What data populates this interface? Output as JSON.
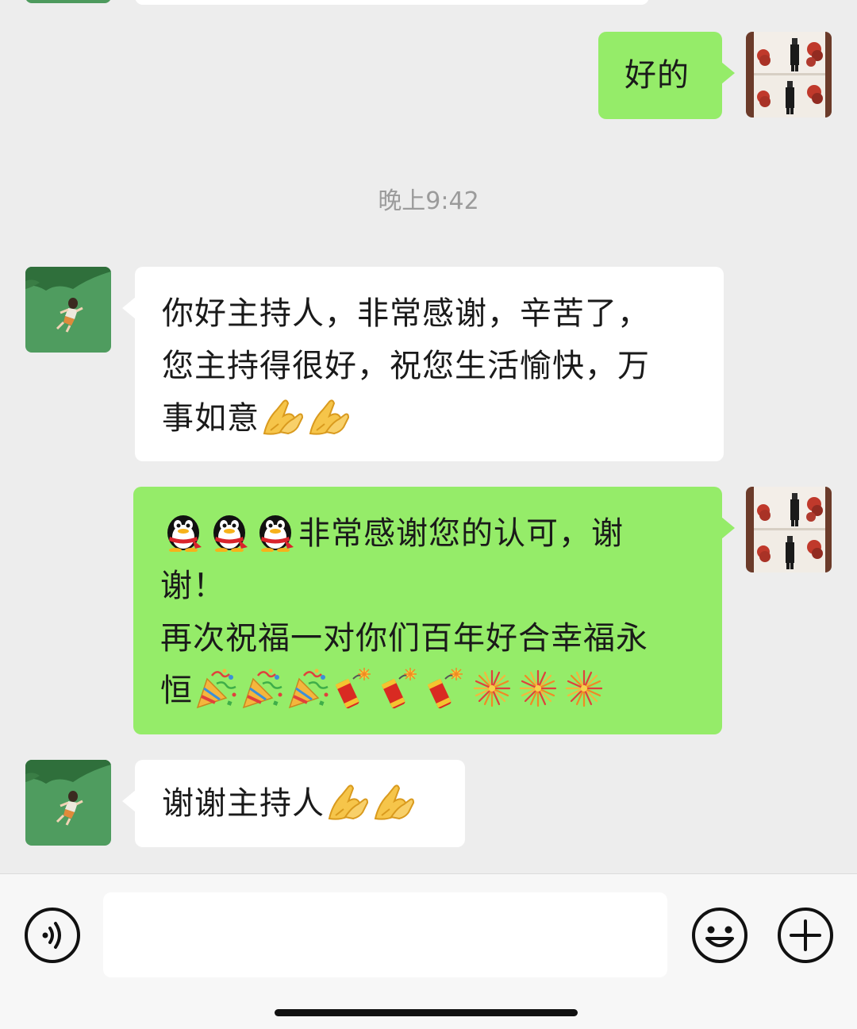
{
  "messages": [
    {
      "side": "right",
      "text": "好的"
    },
    {
      "side": "left",
      "lines": [
        "你好主持人，非常感谢，辛苦了，",
        "您主持得很好，祝您生活愉快，万",
        "事如意"
      ]
    },
    {
      "side": "right",
      "lines": [
        "非常感谢您的认可，谢",
        "谢！",
        "再次祝福一对你们百年好合幸福永",
        "恒"
      ]
    },
    {
      "side": "left",
      "text": "谢谢主持人"
    }
  ],
  "timestamp": "晚上9:42",
  "emoji": {
    "pray": "pray-hands",
    "penguin": "qq-penguin",
    "party": "party-popper",
    "firecracker": "firecracker",
    "fireworks": "fireworks"
  },
  "input": {
    "value": "",
    "placeholder": ""
  },
  "colors": {
    "background": "#ededed",
    "sent_bubble": "#95ec69",
    "received_bubble": "#ffffff",
    "timestamp_text": "#9b9b9b"
  }
}
